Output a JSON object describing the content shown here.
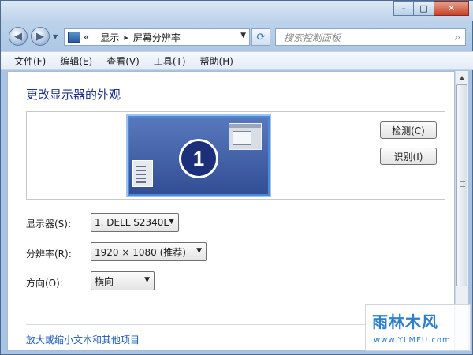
{
  "window": {
    "caption_buttons": {
      "minimize": "–",
      "maximize": "□",
      "close": "✕"
    }
  },
  "address_bar": {
    "prefix": "«",
    "crumbs": [
      "显示",
      "屏幕分辨率"
    ],
    "separator": "▸",
    "placeholder_search": "搜索控制面板"
  },
  "menu": [
    "文件(F)",
    "编辑(E)",
    "查看(V)",
    "工具(T)",
    "帮助(H)"
  ],
  "page": {
    "title": "更改显示器的外观",
    "monitor_number": "1",
    "detect_label": "检测(C)",
    "identify_label": "识别(I)"
  },
  "fields": {
    "display_label": "显示器(S):",
    "display_value": "1. DELL S2340L",
    "resolution_label": "分辨率(R):",
    "resolution_value": "1920 × 1080 (推荐)",
    "orientation_label": "方向(O):",
    "orientation_value": "横向"
  },
  "link_text": "放大或缩小文本和其他项目",
  "watermark": {
    "title": "雨林木风",
    "url": "www.YLMFU.com"
  },
  "colors": {
    "title_blue": "#1e3287",
    "link_blue": "#1c5bb6",
    "monitor_bg": "#324f95"
  },
  "icons": {
    "back": "arrow-left-icon",
    "forward": "arrow-right-icon",
    "refresh": "refresh-icon",
    "search": "search-icon"
  }
}
